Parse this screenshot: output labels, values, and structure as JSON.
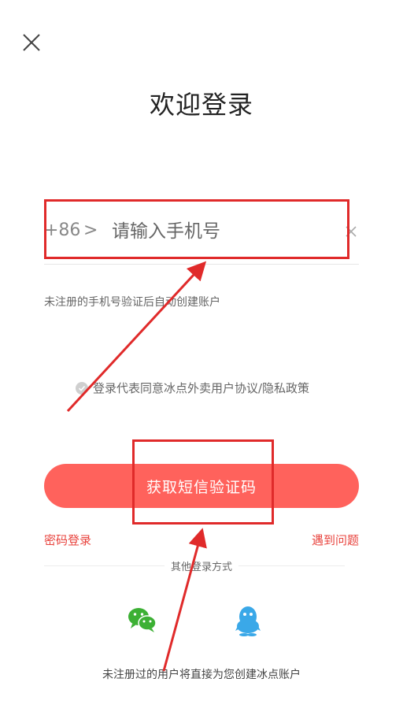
{
  "header": {
    "title": "欢迎登录",
    "close_icon": "close-icon"
  },
  "phone": {
    "country_code": "+86",
    "code_arrow": ">",
    "placeholder": "请输入手机号",
    "value": "",
    "clear_icon": "clear-icon"
  },
  "hint": "未注册的手机号验证后自动创建账户",
  "agreement": {
    "text": "登录代表同意冰点外卖用户协议/隐私政策",
    "checkbox_icon": "check-circle-icon"
  },
  "primary_button": "获取短信验证码",
  "links": {
    "password_login": "密码登录",
    "problem": "遇到问题"
  },
  "other_login": {
    "label": "其他登录方式",
    "options": [
      "wechat-icon",
      "qq-icon"
    ]
  },
  "footer": "未注册过的用户将直接为您创建冰点账户",
  "annotations": {
    "color": "#e02a2a"
  },
  "theme": {
    "accent": "#ff625c",
    "link": "#e8433d"
  }
}
